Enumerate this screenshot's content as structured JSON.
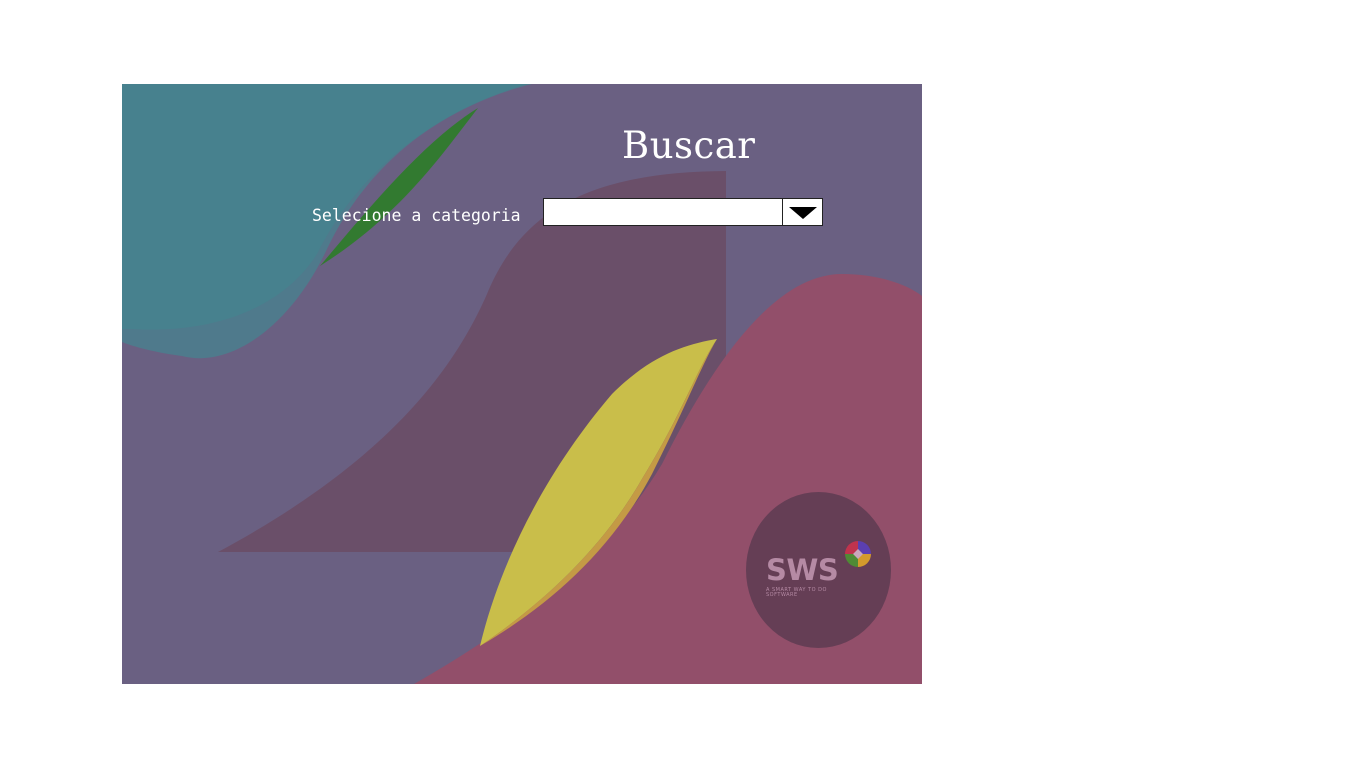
{
  "page": {
    "title": "Buscar"
  },
  "search": {
    "category_label": "Selecione a categoria",
    "category_value": ""
  },
  "logo": {
    "text": "SWS",
    "tagline": "A SMART WAY TO DO SOFTWARE"
  },
  "colors": {
    "panel_background": "#6a6082",
    "teal_shape": "#47818e",
    "crimson_shape": "#924f6a",
    "dark_mauve_shape": "#6a4f69",
    "yellow_shape": "#c9be4a",
    "green_shape": "#327a30",
    "logo_circle": "#653e55",
    "text": "#ffffff"
  },
  "icons": {
    "dropdown": "triangle-down-icon",
    "logo_mark": "four-color-circle-icon"
  }
}
